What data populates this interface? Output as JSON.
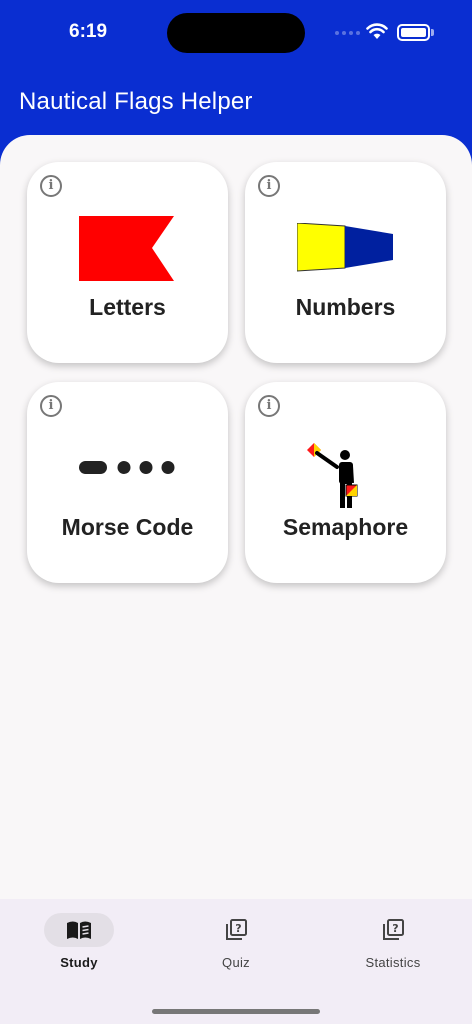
{
  "status": {
    "time": "6:19"
  },
  "app": {
    "title": "Nautical Flags Helper"
  },
  "cards": [
    {
      "label": "Letters",
      "icon": "letter-b-flag-icon"
    },
    {
      "label": "Numbers",
      "icon": "numeral-pennant-icon"
    },
    {
      "label": "Morse Code",
      "icon": "morse-code-icon"
    },
    {
      "label": "Semaphore",
      "icon": "semaphore-figure-icon"
    }
  ],
  "tabs": [
    {
      "label": "Study",
      "icon": "book-icon",
      "active": true
    },
    {
      "label": "Quiz",
      "icon": "question-cards-icon",
      "active": false
    },
    {
      "label": "Statistics",
      "icon": "question-cards-icon",
      "active": false
    }
  ],
  "colors": {
    "header": "#0a2ed1",
    "flag_red": "#ff0000",
    "flag_yellow": "#ffff00",
    "flag_blue": "#00209f"
  }
}
